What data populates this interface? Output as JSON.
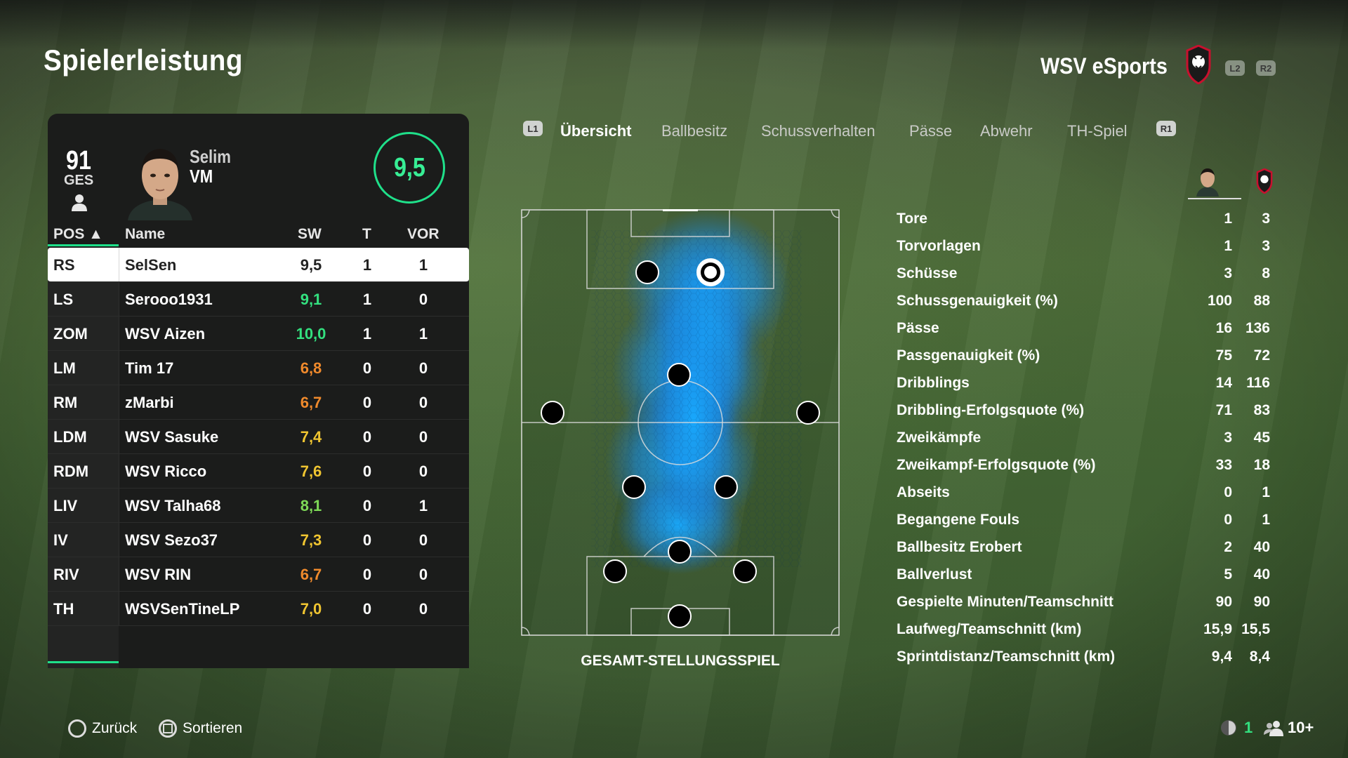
{
  "page": {
    "title": "Spielerleistung"
  },
  "team": {
    "name": "WSV eSports",
    "shoulder_left": "L2",
    "shoulder_right": "R2"
  },
  "player": {
    "overall": "91",
    "overall_label": "GES",
    "name": "Selim",
    "position": "VM",
    "rating": "9,5"
  },
  "table": {
    "headers": {
      "pos": "POS ▲",
      "name": "Name",
      "sw": "SW",
      "t": "T",
      "vor": "VOR"
    },
    "rows": [
      {
        "pos": "RS",
        "name": "SelSen",
        "sw": "9,5",
        "t": "1",
        "vor": "1",
        "color": "#222222"
      },
      {
        "pos": "LS",
        "name": "Serooo1931",
        "sw": "9,1",
        "t": "1",
        "vor": "0",
        "color": "#33e07f"
      },
      {
        "pos": "ZOM",
        "name": "WSV Aizen",
        "sw": "10,0",
        "t": "1",
        "vor": "1",
        "color": "#33e07f"
      },
      {
        "pos": "LM",
        "name": "Tim 17",
        "sw": "6,8",
        "t": "0",
        "vor": "0",
        "color": "#f08a2c"
      },
      {
        "pos": "RM",
        "name": "zMarbi",
        "sw": "6,7",
        "t": "0",
        "vor": "0",
        "color": "#f08a2c"
      },
      {
        "pos": "LDM",
        "name": "WSV Sasuke",
        "sw": "7,4",
        "t": "0",
        "vor": "0",
        "color": "#f0c531"
      },
      {
        "pos": "RDM",
        "name": "WSV Ricco",
        "sw": "7,6",
        "t": "0",
        "vor": "0",
        "color": "#f0c531"
      },
      {
        "pos": "LIV",
        "name": "WSV Talha68",
        "sw": "8,1",
        "t": "0",
        "vor": "1",
        "color": "#7ed957"
      },
      {
        "pos": "IV",
        "name": "WSV Sezo37",
        "sw": "7,3",
        "t": "0",
        "vor": "0",
        "color": "#f0c531"
      },
      {
        "pos": "RIV",
        "name": "WSV RIN",
        "sw": "6,7",
        "t": "0",
        "vor": "0",
        "color": "#f08a2c"
      },
      {
        "pos": "TH",
        "name": "WSVSenTineLP",
        "sw": "7,0",
        "t": "0",
        "vor": "0",
        "color": "#f0c531"
      }
    ]
  },
  "tabs": {
    "left_button": "L1",
    "right_button": "R1",
    "items": [
      "Übersicht",
      "Ballbesitz",
      "Schussverhalten",
      "Pässe",
      "Abwehr",
      "TH-Spiel"
    ],
    "active_index": 0
  },
  "pitch": {
    "caption": "GESAMT-STELLUNGSSPIEL"
  },
  "stats": [
    {
      "label": "Tore",
      "player": "1",
      "team": "3"
    },
    {
      "label": "Torvorlagen",
      "player": "1",
      "team": "3"
    },
    {
      "label": "Schüsse",
      "player": "3",
      "team": "8"
    },
    {
      "label": "Schussgenauigkeit (%)",
      "player": "100",
      "team": "88"
    },
    {
      "label": "Pässe",
      "player": "16",
      "team": "136"
    },
    {
      "label": "Passgenauigkeit (%)",
      "player": "75",
      "team": "72"
    },
    {
      "label": "Dribblings",
      "player": "14",
      "team": "116"
    },
    {
      "label": "Dribbling-Erfolgsquote (%)",
      "player": "71",
      "team": "83"
    },
    {
      "label": "Zweikämpfe",
      "player": "3",
      "team": "45"
    },
    {
      "label": "Zweikampf-Erfolgsquote (%)",
      "player": "33",
      "team": "18"
    },
    {
      "label": "Abseits",
      "player": "0",
      "team": "1"
    },
    {
      "label": "Begangene Fouls",
      "player": "0",
      "team": "1"
    },
    {
      "label": "Ballbesitz Erobert",
      "player": "2",
      "team": "40"
    },
    {
      "label": "Ballverlust",
      "player": "5",
      "team": "40"
    },
    {
      "label": "Gespielte Minuten/Teamschnitt",
      "player": "90",
      "team": "90"
    },
    {
      "label": "Laufweg/Teamschnitt (km)",
      "player": "15,9",
      "team": "15,5"
    },
    {
      "label": "Sprintdistanz/Teamschnitt (km)",
      "player": "9,4",
      "team": "8,4"
    }
  ],
  "footer": {
    "back": "Zurück",
    "sort": "Sortieren",
    "mic_count": "1",
    "players": "10+"
  },
  "colors": {
    "accent": "#1fe08a"
  },
  "icons": [
    "person-icon",
    "lion-crest-icon",
    "circle-button-icon",
    "square-button-icon",
    "mic-icon",
    "players-icon"
  ]
}
